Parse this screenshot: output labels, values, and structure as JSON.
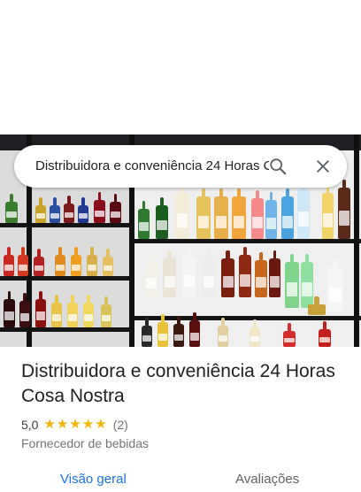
{
  "search": {
    "value": "Distribuidora e conveniência 24 Horas Cosa Nostra"
  },
  "icons": {
    "search": "search-icon",
    "close": "close-icon",
    "star": "star-icon"
  },
  "place": {
    "title": "Distribuidora e conveniência 24 Horas Cosa Nostra",
    "rating": "5,0",
    "stars": 5,
    "review_count": "(2)",
    "category": "Fornecedor de bebidas"
  },
  "tabs": [
    {
      "label": "Visão geral"
    },
    {
      "label": "Avaliações"
    }
  ],
  "colors": {
    "accent": "#1a73e8",
    "star": "#f5b400",
    "text_primary": "#202124",
    "text_secondary": "#70757a"
  }
}
